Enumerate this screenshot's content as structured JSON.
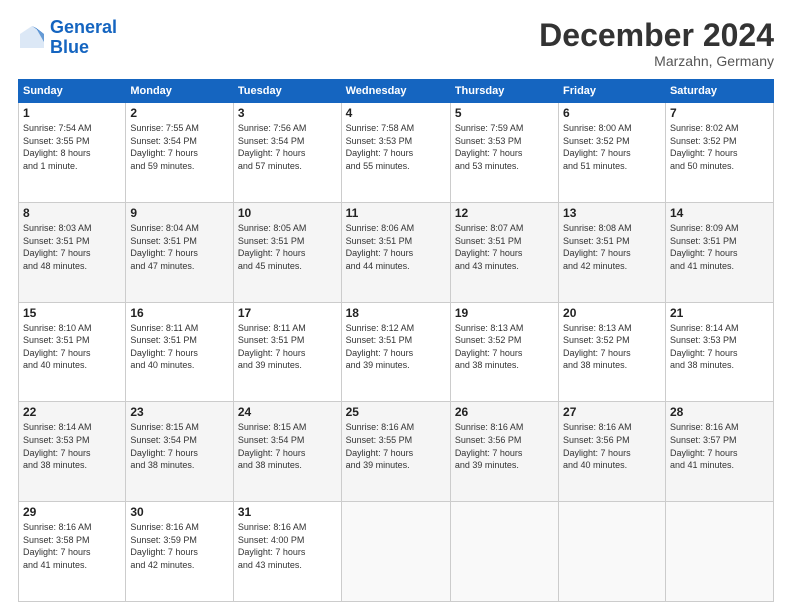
{
  "logo": {
    "line1": "General",
    "line2": "Blue"
  },
  "title": "December 2024",
  "location": "Marzahn, Germany",
  "days_header": [
    "Sunday",
    "Monday",
    "Tuesday",
    "Wednesday",
    "Thursday",
    "Friday",
    "Saturday"
  ],
  "weeks": [
    [
      {
        "day": "1",
        "info": "Sunrise: 7:54 AM\nSunset: 3:55 PM\nDaylight: 8 hours\nand 1 minute."
      },
      {
        "day": "2",
        "info": "Sunrise: 7:55 AM\nSunset: 3:54 PM\nDaylight: 7 hours\nand 59 minutes."
      },
      {
        "day": "3",
        "info": "Sunrise: 7:56 AM\nSunset: 3:54 PM\nDaylight: 7 hours\nand 57 minutes."
      },
      {
        "day": "4",
        "info": "Sunrise: 7:58 AM\nSunset: 3:53 PM\nDaylight: 7 hours\nand 55 minutes."
      },
      {
        "day": "5",
        "info": "Sunrise: 7:59 AM\nSunset: 3:53 PM\nDaylight: 7 hours\nand 53 minutes."
      },
      {
        "day": "6",
        "info": "Sunrise: 8:00 AM\nSunset: 3:52 PM\nDaylight: 7 hours\nand 51 minutes."
      },
      {
        "day": "7",
        "info": "Sunrise: 8:02 AM\nSunset: 3:52 PM\nDaylight: 7 hours\nand 50 minutes."
      }
    ],
    [
      {
        "day": "8",
        "info": "Sunrise: 8:03 AM\nSunset: 3:51 PM\nDaylight: 7 hours\nand 48 minutes."
      },
      {
        "day": "9",
        "info": "Sunrise: 8:04 AM\nSunset: 3:51 PM\nDaylight: 7 hours\nand 47 minutes."
      },
      {
        "day": "10",
        "info": "Sunrise: 8:05 AM\nSunset: 3:51 PM\nDaylight: 7 hours\nand 45 minutes."
      },
      {
        "day": "11",
        "info": "Sunrise: 8:06 AM\nSunset: 3:51 PM\nDaylight: 7 hours\nand 44 minutes."
      },
      {
        "day": "12",
        "info": "Sunrise: 8:07 AM\nSunset: 3:51 PM\nDaylight: 7 hours\nand 43 minutes."
      },
      {
        "day": "13",
        "info": "Sunrise: 8:08 AM\nSunset: 3:51 PM\nDaylight: 7 hours\nand 42 minutes."
      },
      {
        "day": "14",
        "info": "Sunrise: 8:09 AM\nSunset: 3:51 PM\nDaylight: 7 hours\nand 41 minutes."
      }
    ],
    [
      {
        "day": "15",
        "info": "Sunrise: 8:10 AM\nSunset: 3:51 PM\nDaylight: 7 hours\nand 40 minutes."
      },
      {
        "day": "16",
        "info": "Sunrise: 8:11 AM\nSunset: 3:51 PM\nDaylight: 7 hours\nand 40 minutes."
      },
      {
        "day": "17",
        "info": "Sunrise: 8:11 AM\nSunset: 3:51 PM\nDaylight: 7 hours\nand 39 minutes."
      },
      {
        "day": "18",
        "info": "Sunrise: 8:12 AM\nSunset: 3:51 PM\nDaylight: 7 hours\nand 39 minutes."
      },
      {
        "day": "19",
        "info": "Sunrise: 8:13 AM\nSunset: 3:52 PM\nDaylight: 7 hours\nand 38 minutes."
      },
      {
        "day": "20",
        "info": "Sunrise: 8:13 AM\nSunset: 3:52 PM\nDaylight: 7 hours\nand 38 minutes."
      },
      {
        "day": "21",
        "info": "Sunrise: 8:14 AM\nSunset: 3:53 PM\nDaylight: 7 hours\nand 38 minutes."
      }
    ],
    [
      {
        "day": "22",
        "info": "Sunrise: 8:14 AM\nSunset: 3:53 PM\nDaylight: 7 hours\nand 38 minutes."
      },
      {
        "day": "23",
        "info": "Sunrise: 8:15 AM\nSunset: 3:54 PM\nDaylight: 7 hours\nand 38 minutes."
      },
      {
        "day": "24",
        "info": "Sunrise: 8:15 AM\nSunset: 3:54 PM\nDaylight: 7 hours\nand 38 minutes."
      },
      {
        "day": "25",
        "info": "Sunrise: 8:16 AM\nSunset: 3:55 PM\nDaylight: 7 hours\nand 39 minutes."
      },
      {
        "day": "26",
        "info": "Sunrise: 8:16 AM\nSunset: 3:56 PM\nDaylight: 7 hours\nand 39 minutes."
      },
      {
        "day": "27",
        "info": "Sunrise: 8:16 AM\nSunset: 3:56 PM\nDaylight: 7 hours\nand 40 minutes."
      },
      {
        "day": "28",
        "info": "Sunrise: 8:16 AM\nSunset: 3:57 PM\nDaylight: 7 hours\nand 41 minutes."
      }
    ],
    [
      {
        "day": "29",
        "info": "Sunrise: 8:16 AM\nSunset: 3:58 PM\nDaylight: 7 hours\nand 41 minutes."
      },
      {
        "day": "30",
        "info": "Sunrise: 8:16 AM\nSunset: 3:59 PM\nDaylight: 7 hours\nand 42 minutes."
      },
      {
        "day": "31",
        "info": "Sunrise: 8:16 AM\nSunset: 4:00 PM\nDaylight: 7 hours\nand 43 minutes."
      },
      {
        "day": "",
        "info": ""
      },
      {
        "day": "",
        "info": ""
      },
      {
        "day": "",
        "info": ""
      },
      {
        "day": "",
        "info": ""
      }
    ]
  ]
}
